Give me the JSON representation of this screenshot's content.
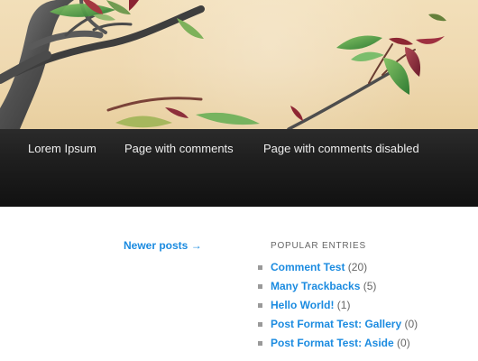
{
  "header": {
    "image": "bonsai-tree-branch-banner"
  },
  "navigation": {
    "items": [
      {
        "label": "Lorem Ipsum"
      },
      {
        "label": "Page with comments"
      },
      {
        "label": "Page with comments disabled"
      }
    ]
  },
  "content": {
    "newer_posts_label": "Newer posts →"
  },
  "sidebar": {
    "widget_title": "Popular Entries",
    "entries": [
      {
        "title": "Comment Test",
        "count": "(20)"
      },
      {
        "title": "Many Trackbacks",
        "count": "(5)"
      },
      {
        "title": "Hello World!",
        "count": "(1)"
      },
      {
        "title": "Post Format Test: Gallery",
        "count": "(0)"
      },
      {
        "title": "Post Format Test: Aside",
        "count": "(0)"
      }
    ]
  },
  "colors": {
    "link": "#1b8be0",
    "nav_background": "#1f1f1f",
    "nav_text": "#eeeeee",
    "muted_text": "#666666"
  }
}
